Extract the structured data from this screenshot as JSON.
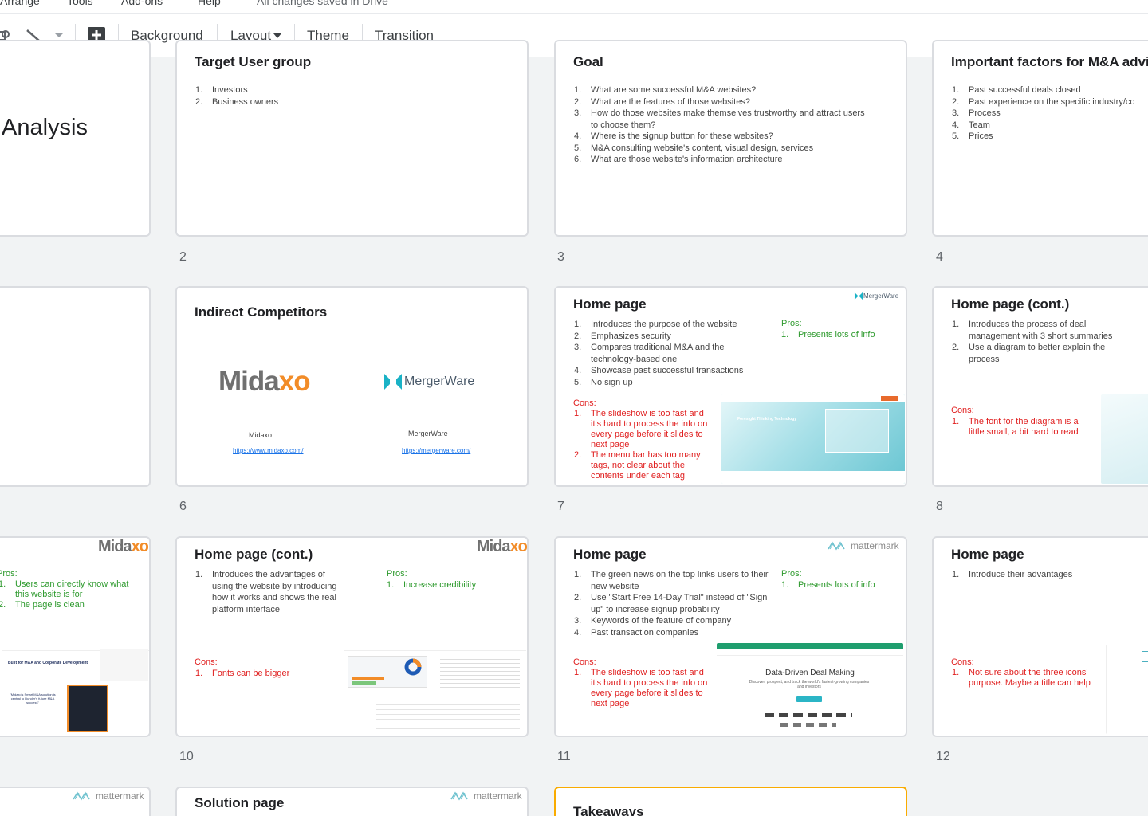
{
  "menubar": {
    "items": [
      "Arrange",
      "Tools",
      "Add-ons",
      "Help"
    ],
    "edit_notice": "All changes saved in Drive"
  },
  "toolbar": {
    "background": "Background",
    "layout": "Layout",
    "theme": "Theme",
    "transition": "Transition"
  },
  "slides": {
    "s1": {
      "title": "Analysis"
    },
    "s2": {
      "title": "Target User group",
      "items": [
        "Investors",
        "Business owners"
      ],
      "num": "2"
    },
    "s3": {
      "title": "Goal",
      "items": [
        "What are some successful M&A websites?",
        "What are the features of those websites?",
        "How do those websites make themselves trustworthy and attract users to choose them?",
        "Where is the signup button for these websites?",
        "M&A consulting website's content, visual design, services",
        "What are those website's information architecture"
      ],
      "num": "3"
    },
    "s4": {
      "title": "Important factors for M&A advi",
      "items": [
        "Past successful deals closed",
        "Past experience on the specific industry/co",
        "Process",
        "Team",
        "Prices"
      ],
      "num": "4"
    },
    "s6": {
      "title": "Indirect Competitors",
      "midaxo_caption": "Midaxo",
      "midaxo_url": "https://www.midaxo.com/",
      "mw_caption": "MergerWare",
      "mw_url": "https://mergerware.com/",
      "num": "6"
    },
    "s7": {
      "title": "Home page",
      "items": [
        "Introduces the purpose of the website",
        "Emphasizes security",
        "Compares traditional M&A and the technology-based one",
        "Showcase past successful transactions",
        "No sign up"
      ],
      "pros_label": "Pros:",
      "pros": [
        "Presents lots of info"
      ],
      "cons_label": "Cons:",
      "cons": [
        "The slideshow is too fast and it's hard to process the info on every page before it slides to next page",
        "The menu bar has too many tags, not clear about the contents under each tag"
      ],
      "thumb_heading": "Foresight Thinking Technology",
      "num": "7"
    },
    "s8": {
      "title": "Home page (cont.)",
      "items": [
        "Introduces the process of deal management with 3 short summaries",
        "Use a diagram to better explain the process"
      ],
      "cons_label": "Cons:",
      "cons": [
        "The font for the diagram is a little small, a bit hard to read"
      ],
      "num": "8"
    },
    "s9": {
      "pros_label": "Pros:",
      "pros": [
        "Users can directly know what this website is for",
        "The page is clean"
      ],
      "thumb_heading": "Built for M&A and Corporate Development",
      "thumb_quote": "\"Midaxo's Smart M&A solution is central to Dunder's future M&A success\""
    },
    "s10": {
      "title": "Home page (cont.)",
      "items_html": [
        "Introduces the advantages of using the website by introducing how it works and shows the real platform interface"
      ],
      "pros_label": "Pros:",
      "pros": [
        "Increase credibility"
      ],
      "cons_label": "Cons:",
      "cons": [
        "Fonts can be bigger"
      ],
      "num": "10"
    },
    "s11": {
      "title": "Home page",
      "items": [
        "The green news on the top links users to their new website",
        "Use \"Start Free 14-Day Trial\" instead of \"Sign up\" to increase signup probability",
        "Keywords of the feature of company",
        "Past transaction companies"
      ],
      "pros_label": "Pros:",
      "pros": [
        "Presents lots of info"
      ],
      "cons_label": "Cons:",
      "cons": [
        "The slideshow is too fast and it's hard to process the info on every page before it slides to next page"
      ],
      "thumb_heading": "Data-Driven Deal Making",
      "thumb_sub": "Discover, prospect, and track the world's fastest-growing companies and investors",
      "num": "11"
    },
    "s12": {
      "title": "Home page",
      "items": [
        "Introduce their advantages"
      ],
      "cons_label": "Cons:",
      "cons": [
        "Not sure about the three icons' purpose. Maybe a title can help"
      ],
      "num": "12"
    },
    "s14": {
      "title": "Solution page"
    },
    "s15": {
      "title": "Takeaways"
    }
  },
  "logos": {
    "midaxo": "Midaxo",
    "mergerware": "MergerWare",
    "mattermark": "mattermark"
  },
  "colors": {
    "accent_selected": "#f9ab00",
    "pros": "#2e9a2e",
    "cons": "#e02020"
  }
}
